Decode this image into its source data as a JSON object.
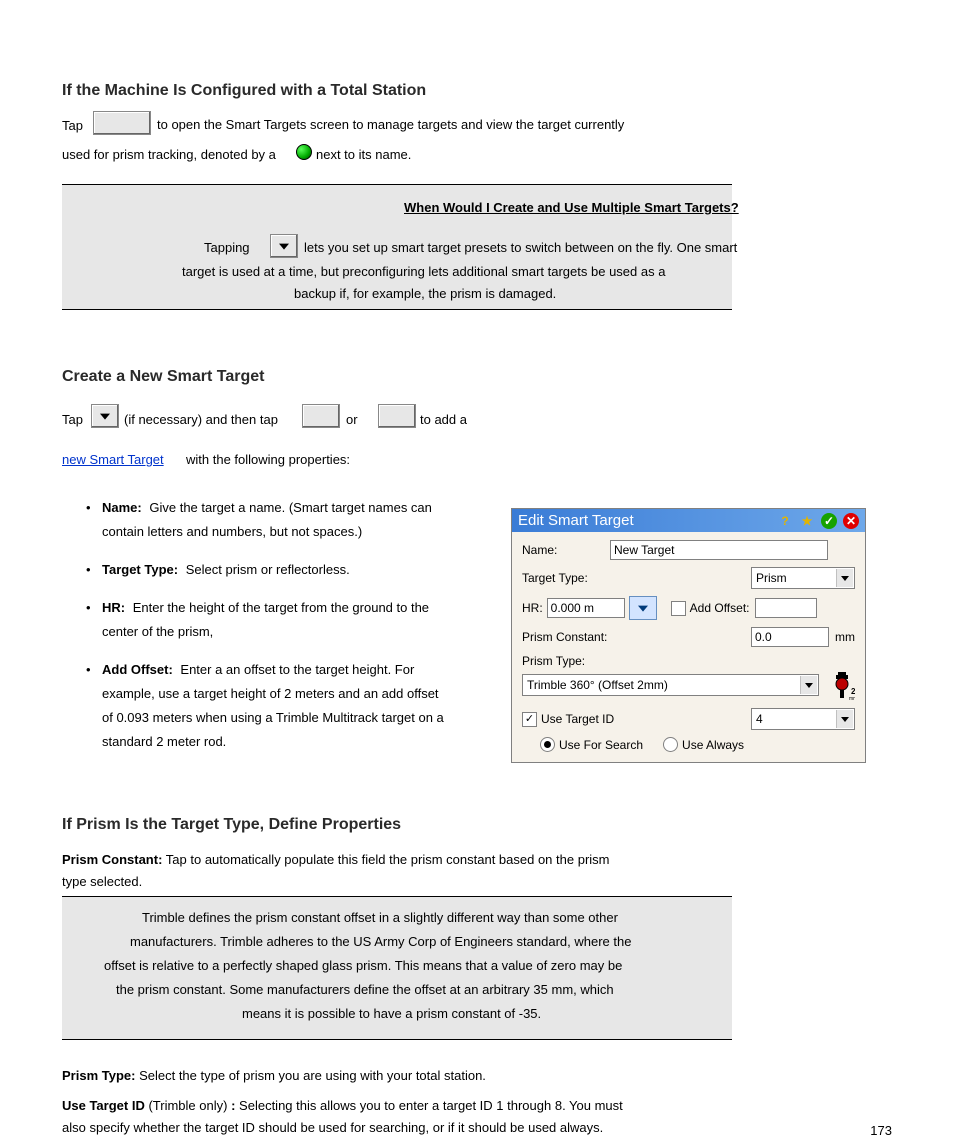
{
  "section1": {
    "heading1": "If the Machine Is Configured with a Total Station",
    "p1a": "Tap ",
    "p1b": " to open the Smart Targets screen to manage targets and view the target currently",
    "p1c": "used for prism tracking, denoted by a ",
    "p1d": " next to its name.",
    "callout": {
      "title": "When Would I Create and Use Multiple Smart Targets?",
      "line1a": "Tapping ",
      "line1b": " lets you set up smart target presets to switch between on the fly. One smart",
      "line2": "target is used at a time, but preconfiguring lets additional smart targets be used as a",
      "line3": "backup if, for example, the prism is damaged.",
      "callout_link_label": "When Would I Create and Use Multiple Smart Targets?"
    }
  },
  "section2": {
    "heading": "Create a New Smart Target",
    "line1a": "Tap ",
    "line1b": " (if necessary) and then tap ",
    "line1c": " or ",
    "line1d": " to add a",
    "link_text": "new Smart Target",
    "line2b": " with the following properties:",
    "props": [
      {
        "label": "Name:",
        "text": "Give the target a name. (Smart target names can",
        "text2": "contain letters and numbers, but not spaces.)"
      },
      {
        "label": "Target Type:",
        "text": "Select prism or reflectorless."
      },
      {
        "label": "HR:",
        "text": "Enter the height of the target from the ground to the",
        "text2": "center of the prism,"
      },
      {
        "label": "Add Offset:",
        "text": "Enter a an offset to the target height. For",
        "text2": "example, use a target height of 2 meters and an add offset",
        "text3": "of 0.093 meters when using a Trimble Multitrack target on a",
        "text4": "standard 2 meter rod."
      }
    ]
  },
  "dialog": {
    "title": "Edit Smart Target",
    "name": {
      "label": "Name:",
      "value": "New Target"
    },
    "target_type": {
      "label": "Target Type:",
      "value": "Prism"
    },
    "hr": {
      "label": "HR:",
      "value": "0.000 m"
    },
    "add_offset": {
      "label": "Add Offset:",
      "value": ""
    },
    "prism_constant": {
      "label": "Prism Constant:",
      "value": "0.0",
      "unit": "mm"
    },
    "prism_type": {
      "label": "Prism Type:",
      "value": "Trimble 360° (Offset 2mm)",
      "icon_badge": "2"
    },
    "use_target_id": {
      "label": "Use Target ID",
      "value": "4"
    },
    "radio_search": "Use For Search",
    "radio_always": "Use Always"
  },
  "section3": {
    "heading": "If Prism Is the Target Type, Define Properties",
    "p1": {
      "l1": "Prism Constant: Tap to automatically populate this field the prism constant based on the prism",
      "l2": "type selected."
    },
    "callout": {
      "l1": "Trimble defines the prism constant offset in a slightly different way than some other",
      "l2": "manufacturers. Trimble adheres to the US Army Corp of Engineers standard, where the",
      "l3": "offset is relative to a perfectly shaped glass prism. This means that a value of zero may be",
      "l4": "the prism constant. Some manufacturers define the offset at an arbitrary 35 mm, which",
      "l5": "means it is possible to have a prism constant of -35."
    },
    "p2": "Prism Type: Select the type of prism you are using with your total station.",
    "p3": {
      "l1": "Use Target ID (Trimble only): Selecting this allows you to enter a target ID 1 through 8. You must",
      "l2": "also specify whether the target ID should be used for searching, or if it should be used always."
    }
  },
  "footer_page": "173"
}
